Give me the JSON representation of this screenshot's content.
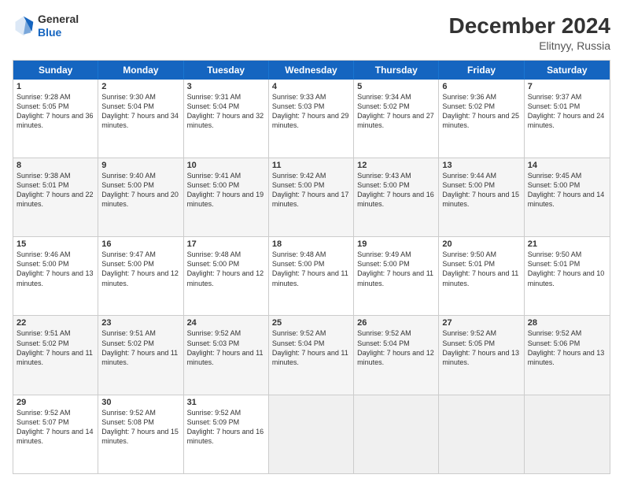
{
  "logo": {
    "general": "General",
    "blue": "Blue"
  },
  "header": {
    "month": "December 2024",
    "location": "Elitnyy, Russia"
  },
  "weekdays": [
    "Sunday",
    "Monday",
    "Tuesday",
    "Wednesday",
    "Thursday",
    "Friday",
    "Saturday"
  ],
  "rows": [
    [
      {
        "day": "1",
        "sr": "Sunrise: 9:28 AM",
        "ss": "Sunset: 5:05 PM",
        "dl": "Daylight: 7 hours and 36 minutes."
      },
      {
        "day": "2",
        "sr": "Sunrise: 9:30 AM",
        "ss": "Sunset: 5:04 PM",
        "dl": "Daylight: 7 hours and 34 minutes."
      },
      {
        "day": "3",
        "sr": "Sunrise: 9:31 AM",
        "ss": "Sunset: 5:04 PM",
        "dl": "Daylight: 7 hours and 32 minutes."
      },
      {
        "day": "4",
        "sr": "Sunrise: 9:33 AM",
        "ss": "Sunset: 5:03 PM",
        "dl": "Daylight: 7 hours and 29 minutes."
      },
      {
        "day": "5",
        "sr": "Sunrise: 9:34 AM",
        "ss": "Sunset: 5:02 PM",
        "dl": "Daylight: 7 hours and 27 minutes."
      },
      {
        "day": "6",
        "sr": "Sunrise: 9:36 AM",
        "ss": "Sunset: 5:02 PM",
        "dl": "Daylight: 7 hours and 25 minutes."
      },
      {
        "day": "7",
        "sr": "Sunrise: 9:37 AM",
        "ss": "Sunset: 5:01 PM",
        "dl": "Daylight: 7 hours and 24 minutes."
      }
    ],
    [
      {
        "day": "8",
        "sr": "Sunrise: 9:38 AM",
        "ss": "Sunset: 5:01 PM",
        "dl": "Daylight: 7 hours and 22 minutes."
      },
      {
        "day": "9",
        "sr": "Sunrise: 9:40 AM",
        "ss": "Sunset: 5:00 PM",
        "dl": "Daylight: 7 hours and 20 minutes."
      },
      {
        "day": "10",
        "sr": "Sunrise: 9:41 AM",
        "ss": "Sunset: 5:00 PM",
        "dl": "Daylight: 7 hours and 19 minutes."
      },
      {
        "day": "11",
        "sr": "Sunrise: 9:42 AM",
        "ss": "Sunset: 5:00 PM",
        "dl": "Daylight: 7 hours and 17 minutes."
      },
      {
        "day": "12",
        "sr": "Sunrise: 9:43 AM",
        "ss": "Sunset: 5:00 PM",
        "dl": "Daylight: 7 hours and 16 minutes."
      },
      {
        "day": "13",
        "sr": "Sunrise: 9:44 AM",
        "ss": "Sunset: 5:00 PM",
        "dl": "Daylight: 7 hours and 15 minutes."
      },
      {
        "day": "14",
        "sr": "Sunrise: 9:45 AM",
        "ss": "Sunset: 5:00 PM",
        "dl": "Daylight: 7 hours and 14 minutes."
      }
    ],
    [
      {
        "day": "15",
        "sr": "Sunrise: 9:46 AM",
        "ss": "Sunset: 5:00 PM",
        "dl": "Daylight: 7 hours and 13 minutes."
      },
      {
        "day": "16",
        "sr": "Sunrise: 9:47 AM",
        "ss": "Sunset: 5:00 PM",
        "dl": "Daylight: 7 hours and 12 minutes."
      },
      {
        "day": "17",
        "sr": "Sunrise: 9:48 AM",
        "ss": "Sunset: 5:00 PM",
        "dl": "Daylight: 7 hours and 12 minutes."
      },
      {
        "day": "18",
        "sr": "Sunrise: 9:48 AM",
        "ss": "Sunset: 5:00 PM",
        "dl": "Daylight: 7 hours and 11 minutes."
      },
      {
        "day": "19",
        "sr": "Sunrise: 9:49 AM",
        "ss": "Sunset: 5:00 PM",
        "dl": "Daylight: 7 hours and 11 minutes."
      },
      {
        "day": "20",
        "sr": "Sunrise: 9:50 AM",
        "ss": "Sunset: 5:01 PM",
        "dl": "Daylight: 7 hours and 11 minutes."
      },
      {
        "day": "21",
        "sr": "Sunrise: 9:50 AM",
        "ss": "Sunset: 5:01 PM",
        "dl": "Daylight: 7 hours and 10 minutes."
      }
    ],
    [
      {
        "day": "22",
        "sr": "Sunrise: 9:51 AM",
        "ss": "Sunset: 5:02 PM",
        "dl": "Daylight: 7 hours and 11 minutes."
      },
      {
        "day": "23",
        "sr": "Sunrise: 9:51 AM",
        "ss": "Sunset: 5:02 PM",
        "dl": "Daylight: 7 hours and 11 minutes."
      },
      {
        "day": "24",
        "sr": "Sunrise: 9:52 AM",
        "ss": "Sunset: 5:03 PM",
        "dl": "Daylight: 7 hours and 11 minutes."
      },
      {
        "day": "25",
        "sr": "Sunrise: 9:52 AM",
        "ss": "Sunset: 5:04 PM",
        "dl": "Daylight: 7 hours and 11 minutes."
      },
      {
        "day": "26",
        "sr": "Sunrise: 9:52 AM",
        "ss": "Sunset: 5:04 PM",
        "dl": "Daylight: 7 hours and 12 minutes."
      },
      {
        "day": "27",
        "sr": "Sunrise: 9:52 AM",
        "ss": "Sunset: 5:05 PM",
        "dl": "Daylight: 7 hours and 13 minutes."
      },
      {
        "day": "28",
        "sr": "Sunrise: 9:52 AM",
        "ss": "Sunset: 5:06 PM",
        "dl": "Daylight: 7 hours and 13 minutes."
      }
    ],
    [
      {
        "day": "29",
        "sr": "Sunrise: 9:52 AM",
        "ss": "Sunset: 5:07 PM",
        "dl": "Daylight: 7 hours and 14 minutes."
      },
      {
        "day": "30",
        "sr": "Sunrise: 9:52 AM",
        "ss": "Sunset: 5:08 PM",
        "dl": "Daylight: 7 hours and 15 minutes."
      },
      {
        "day": "31",
        "sr": "Sunrise: 9:52 AM",
        "ss": "Sunset: 5:09 PM",
        "dl": "Daylight: 7 hours and 16 minutes."
      },
      null,
      null,
      null,
      null
    ]
  ]
}
